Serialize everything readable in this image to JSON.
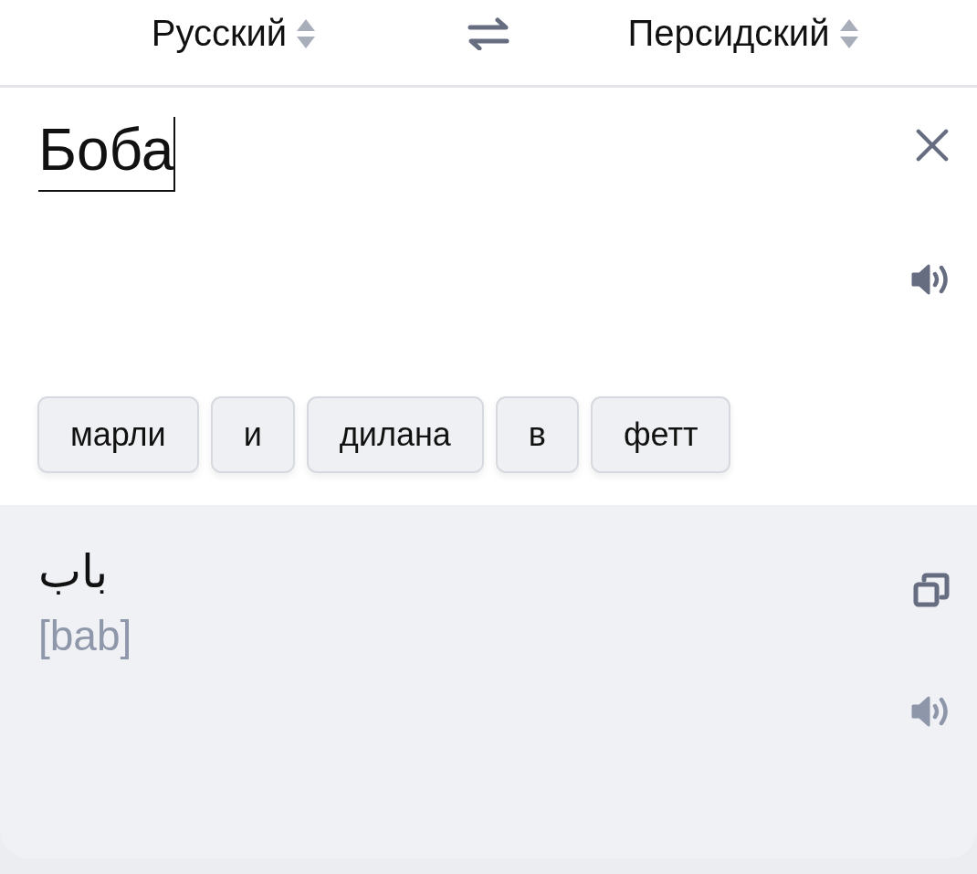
{
  "header": {
    "source_language": "Русский",
    "target_language": "Персидский"
  },
  "input": {
    "value": "Боба"
  },
  "suggestions": [
    "марли",
    "и",
    "дилана",
    "в",
    "фетт"
  ],
  "translation": {
    "text": "باب",
    "transliteration": "[bab]"
  }
}
